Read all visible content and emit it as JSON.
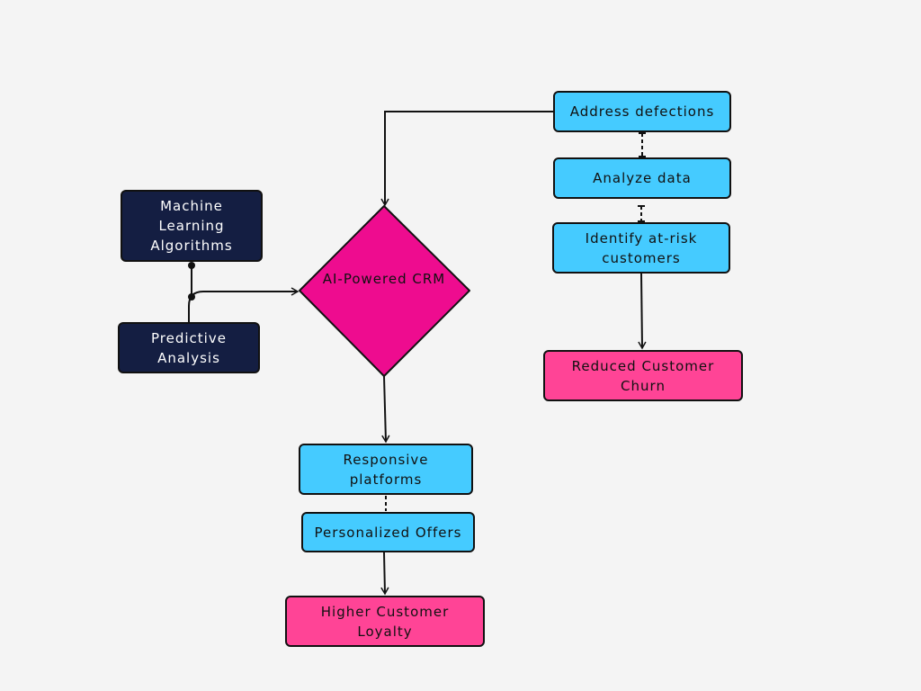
{
  "colors": {
    "navy": "#141e42",
    "cyan": "#45cbff",
    "pink": "#ff4496",
    "magenta": "#ee0c8f",
    "background": "#f4f4f4"
  },
  "nodes": {
    "ml": "Machine Learning Algorithms",
    "predictive": "Predictive Analysis",
    "crm": "AI-Powered CRM",
    "address": "Address defections",
    "analyze": "Analyze data",
    "identify": "Identify at-risk customers",
    "reduced": "Reduced Customer Churn",
    "responsive": "Responsive platforms",
    "personalized": "Personalized Offers",
    "loyalty": "Higher Customer Loyalty"
  }
}
